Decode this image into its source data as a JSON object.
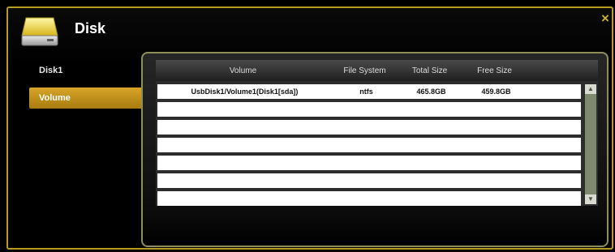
{
  "window": {
    "title": "Disk",
    "close_icon": "×"
  },
  "sidebar": {
    "items": [
      {
        "label": "Disk1",
        "active": false
      },
      {
        "label": "Volume",
        "active": true
      }
    ]
  },
  "table": {
    "columns": [
      "Volume",
      "File System",
      "Total Size",
      "Free Size"
    ],
    "rows": [
      [
        "UsbDisk1/Volume1(Disk1[sda])",
        "ntfs",
        "465.8GB",
        "459.8GB"
      ]
    ],
    "empty_rows": 6
  },
  "icons": {
    "title": "disk-icon",
    "close": "close-icon",
    "scroll_up": "chevron-up-icon",
    "scroll_down": "chevron-down-icon"
  },
  "colors": {
    "accent": "#d8a52a",
    "border": "#b89a1e",
    "panel_border": "#8e8f58",
    "scrollbar": "#7e8a6e"
  }
}
